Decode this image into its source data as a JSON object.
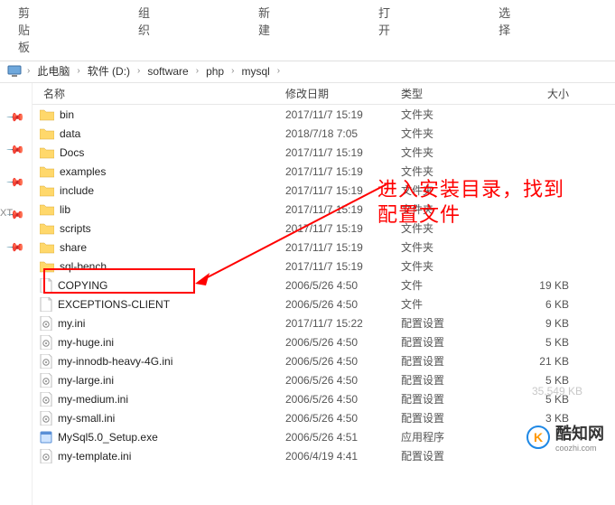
{
  "toolbar": {
    "clipboard": "剪贴板",
    "organize": "组织",
    "new": "新建",
    "open": "打开",
    "select": "选择"
  },
  "breadcrumb": {
    "items": [
      "此电脑",
      "软件 (D:)",
      "software",
      "php",
      "mysql"
    ]
  },
  "columns": {
    "name": "名称",
    "date": "修改日期",
    "type": "类型",
    "size": "大小"
  },
  "files": [
    {
      "icon": "folder",
      "name": "bin",
      "date": "2017/11/7 15:19",
      "type": "文件夹",
      "size": ""
    },
    {
      "icon": "folder",
      "name": "data",
      "date": "2018/7/18 7:05",
      "type": "文件夹",
      "size": ""
    },
    {
      "icon": "folder",
      "name": "Docs",
      "date": "2017/11/7 15:19",
      "type": "文件夹",
      "size": ""
    },
    {
      "icon": "folder",
      "name": "examples",
      "date": "2017/11/7 15:19",
      "type": "文件夹",
      "size": ""
    },
    {
      "icon": "folder",
      "name": "include",
      "date": "2017/11/7 15:19",
      "type": "文件夹",
      "size": ""
    },
    {
      "icon": "folder",
      "name": "lib",
      "date": "2017/11/7 15:19",
      "type": "文件夹",
      "size": ""
    },
    {
      "icon": "folder",
      "name": "scripts",
      "date": "2017/11/7 15:19",
      "type": "文件夹",
      "size": ""
    },
    {
      "icon": "folder",
      "name": "share",
      "date": "2017/11/7 15:19",
      "type": "文件夹",
      "size": ""
    },
    {
      "icon": "folder",
      "name": "sql-bench",
      "date": "2017/11/7 15:19",
      "type": "文件夹",
      "size": ""
    },
    {
      "icon": "file",
      "name": "COPYING",
      "date": "2006/5/26 4:50",
      "type": "文件",
      "size": "19 KB"
    },
    {
      "icon": "file",
      "name": "EXCEPTIONS-CLIENT",
      "date": "2006/5/26 4:50",
      "type": "文件",
      "size": "6 KB"
    },
    {
      "icon": "ini",
      "name": "my.ini",
      "date": "2017/11/7 15:22",
      "type": "配置设置",
      "size": "9 KB"
    },
    {
      "icon": "ini",
      "name": "my-huge.ini",
      "date": "2006/5/26 4:50",
      "type": "配置设置",
      "size": "5 KB"
    },
    {
      "icon": "ini",
      "name": "my-innodb-heavy-4G.ini",
      "date": "2006/5/26 4:50",
      "type": "配置设置",
      "size": "21 KB"
    },
    {
      "icon": "ini",
      "name": "my-large.ini",
      "date": "2006/5/26 4:50",
      "type": "配置设置",
      "size": "5 KB"
    },
    {
      "icon": "ini",
      "name": "my-medium.ini",
      "date": "2006/5/26 4:50",
      "type": "配置设置",
      "size": "5 KB"
    },
    {
      "icon": "ini",
      "name": "my-small.ini",
      "date": "2006/5/26 4:50",
      "type": "配置设置",
      "size": "3 KB"
    },
    {
      "icon": "exe",
      "name": "MySql5.0_Setup.exe",
      "date": "2006/5/26 4:51",
      "type": "应用程序",
      "size": ""
    },
    {
      "icon": "ini",
      "name": "my-template.ini",
      "date": "2006/4/19 4:41",
      "type": "配置设置",
      "size": ""
    }
  ],
  "annotation": {
    "line1": "进入安装目录，找到",
    "line2": "配置文件"
  },
  "faded_size": "35,549 KB",
  "side_label": "XT",
  "watermark": {
    "logo": "K",
    "text": "酷知网",
    "sub": "coozhi.com"
  }
}
